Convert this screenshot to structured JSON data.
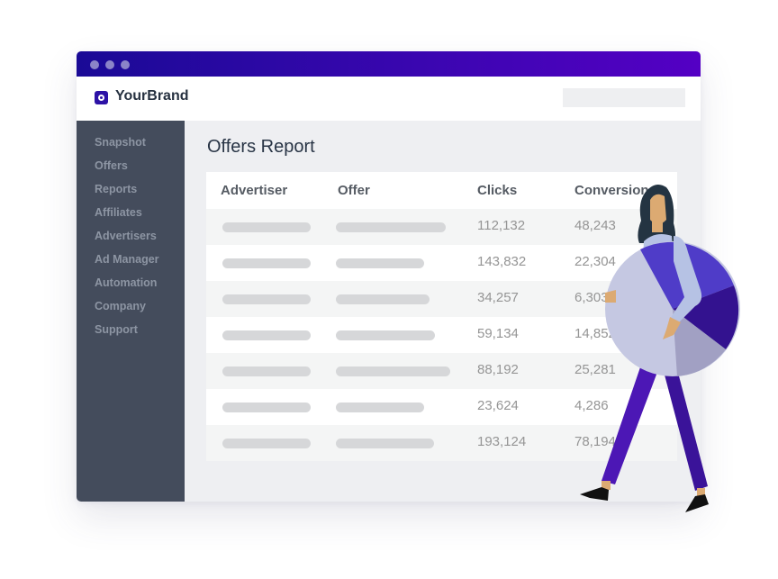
{
  "window": {
    "controls": [
      "dot",
      "dot",
      "dot"
    ],
    "brand": {
      "name": "YourBrand",
      "icon": "brand-logo-icon"
    },
    "search": {
      "placeholder": ""
    }
  },
  "sidebar": {
    "items": [
      {
        "label": "Snapshot"
      },
      {
        "label": "Offers"
      },
      {
        "label": "Reports"
      },
      {
        "label": "Affiliates"
      },
      {
        "label": "Advertisers"
      },
      {
        "label": "Ad Manager"
      },
      {
        "label": "Automation"
      },
      {
        "label": "Company"
      },
      {
        "label": "Support"
      }
    ]
  },
  "main": {
    "title": "Offers Report",
    "table": {
      "columns": [
        "Advertiser",
        "Offer",
        "Clicks",
        "Conversions"
      ],
      "rows": [
        {
          "advertiser": "",
          "offer": "",
          "clicks": "112,132",
          "conversions": "48,243"
        },
        {
          "advertiser": "",
          "offer": "",
          "clicks": "143,832",
          "conversions": "22,304"
        },
        {
          "advertiser": "",
          "offer": "",
          "clicks": "34,257",
          "conversions": "6,303"
        },
        {
          "advertiser": "",
          "offer": "",
          "clicks": "59,134",
          "conversions": "14,852"
        },
        {
          "advertiser": "",
          "offer": "",
          "clicks": "88,192",
          "conversions": "25,281"
        },
        {
          "advertiser": "",
          "offer": "",
          "clicks": "23,624",
          "conversions": "4,286"
        },
        {
          "advertiser": "",
          "offer": "",
          "clicks": "193,124",
          "conversions": "78,194"
        }
      ]
    }
  },
  "illustration": {
    "subject": "woman-carrying-pie-chart",
    "colors": {
      "pie_main": "#c5c8e2",
      "pie_slice_1": "#4f3cc8",
      "pie_slice_2": "#33128f",
      "pie_slice_3": "#a1a0c3",
      "pants": "#4c17b5",
      "hair": "#243442",
      "skin": "#dcaa72"
    }
  },
  "colors": {
    "titlebar_start": "#1a0a96",
    "titlebar_end": "#5400c4",
    "sidebar_bg": "#444c5c",
    "brand_accent": "#2d12a6"
  }
}
